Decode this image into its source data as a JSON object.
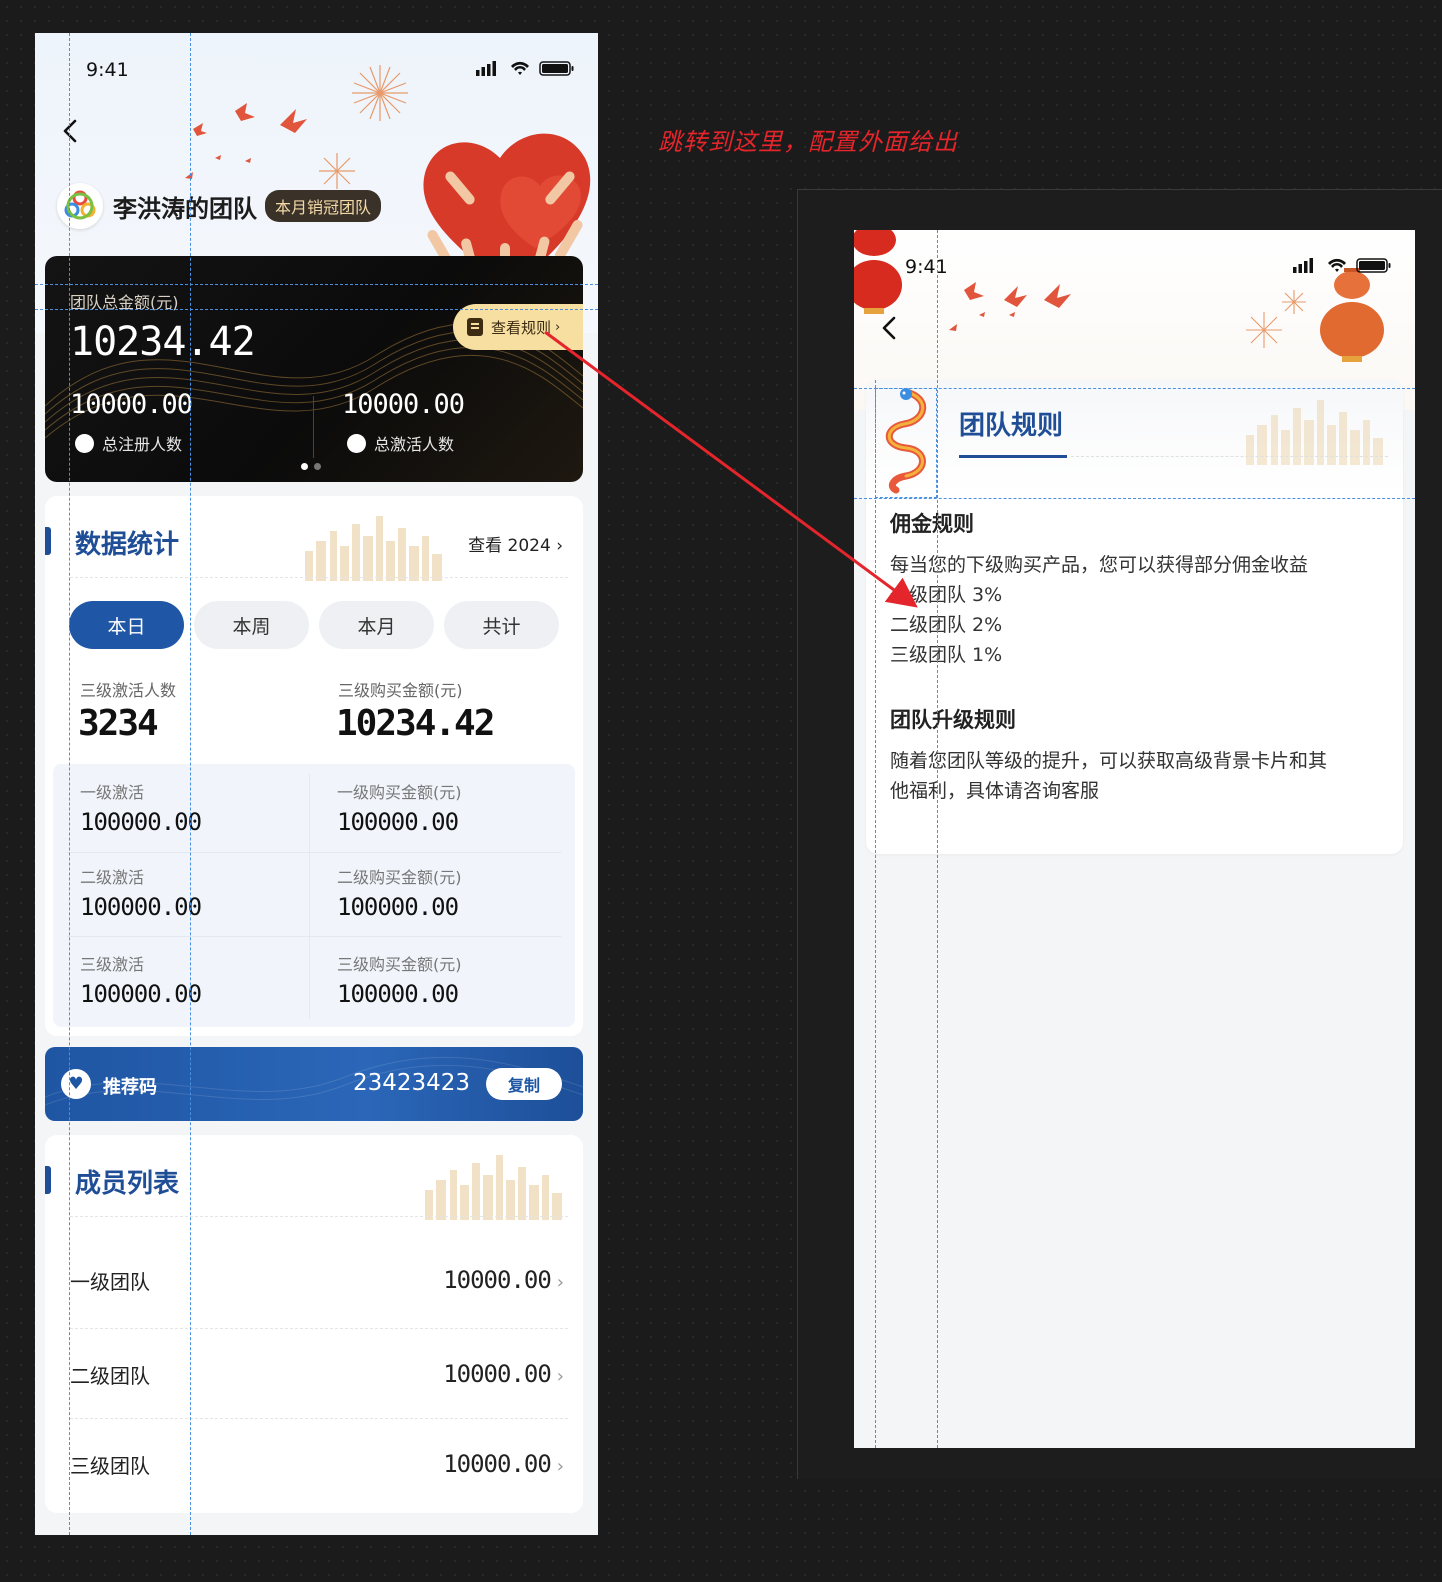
{
  "annotation": "跳转到这里，配置外面给出",
  "screen1": {
    "status_time": "9:41",
    "team_name": "李洪涛的团队",
    "team_badge": "本月销冠团队",
    "card": {
      "total_label": "团队总金额(元)",
      "total_amount": "10234.42",
      "rule_button": "查看规则",
      "registered_value": "10000.00",
      "registered_label": "总注册人数",
      "activated_value": "10000.00",
      "activated_label": "总激活人数"
    },
    "stats": {
      "title": "数据统计",
      "view_year": "查看 2024",
      "tabs": [
        "本日",
        "本周",
        "本月",
        "共计"
      ],
      "active_tab": 0,
      "kpi_left_label": "三级激活人数",
      "kpi_left_value": "3234",
      "kpi_right_label": "三级购买金额(元)",
      "kpi_right_value": "10234.42",
      "rows": [
        {
          "left_label": "一级激活",
          "left_value": "100000.00",
          "right_label": "一级购买金额(元)",
          "right_value": "100000.00"
        },
        {
          "left_label": "二级激活",
          "left_value": "100000.00",
          "right_label": "二级购买金额(元)",
          "right_value": "100000.00"
        },
        {
          "left_label": "三级激活",
          "left_value": "100000.00",
          "right_label": "三级购买金额(元)",
          "right_value": "100000.00"
        }
      ]
    },
    "referral": {
      "label": "推荐码",
      "code": "23423423",
      "copy": "复制"
    },
    "members": {
      "title": "成员列表",
      "rows": [
        {
          "name": "一级团队",
          "value": "10000.00"
        },
        {
          "name": "二级团队",
          "value": "10000.00"
        },
        {
          "name": "三级团队",
          "value": "10000.00"
        }
      ]
    }
  },
  "screen2": {
    "status_time": "9:41",
    "title": "团队规则",
    "sections": [
      {
        "heading": "佣金规则",
        "lines": [
          "每当您的下级购买产品，您可以获得部分佣金收益",
          "一级团队 3%",
          "二级团队 2%",
          "三级团队 1%"
        ]
      },
      {
        "heading": "团队升级规则",
        "lines": [
          "随着您团队等级的提升，可以获取高级背景卡片和其",
          "他福利，具体请咨询客服"
        ]
      }
    ]
  },
  "colors": {
    "brand_blue": "#1f4e97",
    "gold": "#f6dfa1",
    "annotation_red": "#e4252b"
  }
}
